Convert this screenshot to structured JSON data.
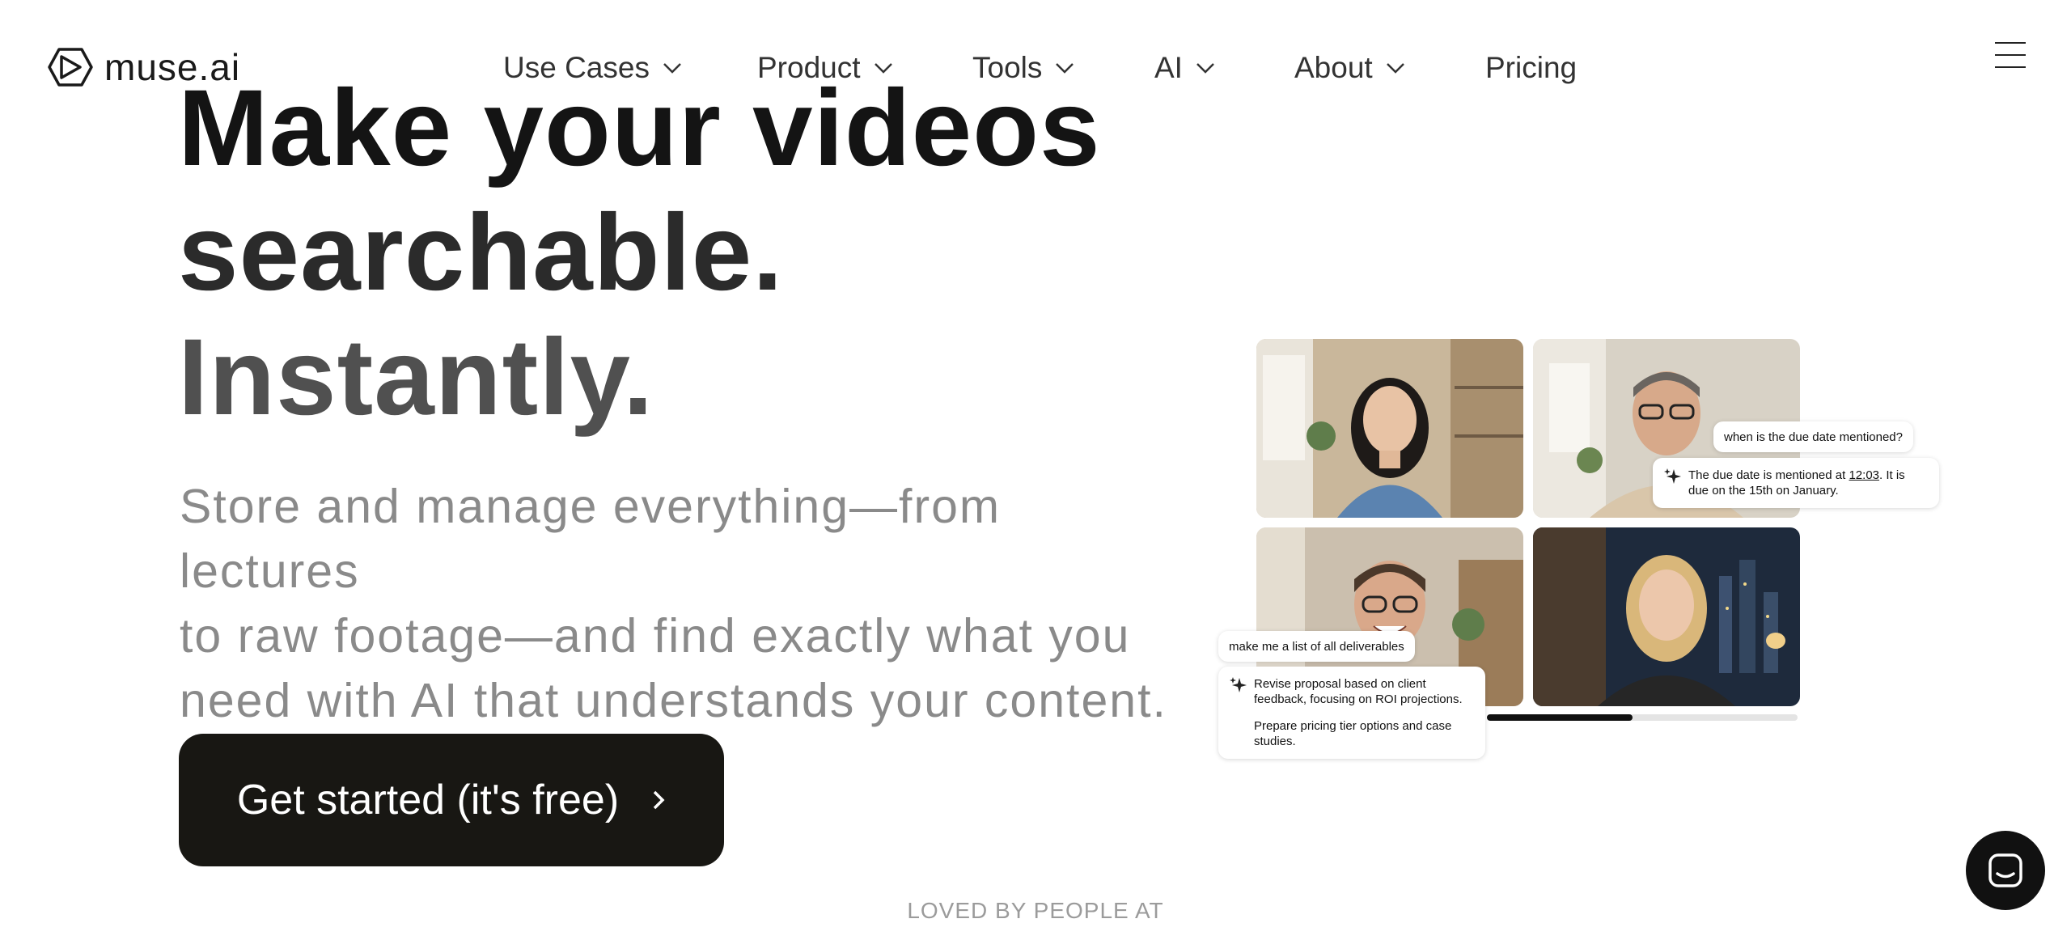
{
  "brand": {
    "name": "muse.ai"
  },
  "nav": {
    "items": [
      {
        "label": "Use Cases",
        "dropdown": true
      },
      {
        "label": "Product",
        "dropdown": true
      },
      {
        "label": "Tools",
        "dropdown": true
      },
      {
        "label": "AI",
        "dropdown": true
      },
      {
        "label": "About",
        "dropdown": true
      },
      {
        "label": "Pricing",
        "dropdown": false
      }
    ],
    "menu_icon": "hamburger-icon"
  },
  "hero": {
    "title_lines": [
      "Make your videos",
      "searchable.",
      "Instantly."
    ],
    "subtitle_lines": [
      "Store and manage everything—from lectures",
      "to raw footage—and find exactly what you",
      "need with AI that understands your content."
    ],
    "cta": {
      "label": "Get started (it's free)",
      "icon": "chevron-right-icon"
    }
  },
  "demo": {
    "question_1": "when is the due date mentioned?",
    "answer_1": {
      "prefix": "The due date is mentioned at ",
      "timestamp": "12:03",
      "suffix": ". It is due on the 15th on January."
    },
    "question_2": "make me a list of all deliverables",
    "answer_2_items": [
      "Revise proposal based on client feedback, focusing on ROI projections.",
      "Prepare pricing tier options and case studies."
    ],
    "playback_progress": 0.47
  },
  "social_proof": {
    "label": "LOVED BY PEOPLE AT"
  },
  "chat": {
    "icon": "chat-bubble-icon"
  },
  "colors": {
    "cta_bg": "#181713",
    "text_dark": "#141414",
    "subtitle": "#8a8a8a",
    "muted": "#9b9b9b"
  }
}
